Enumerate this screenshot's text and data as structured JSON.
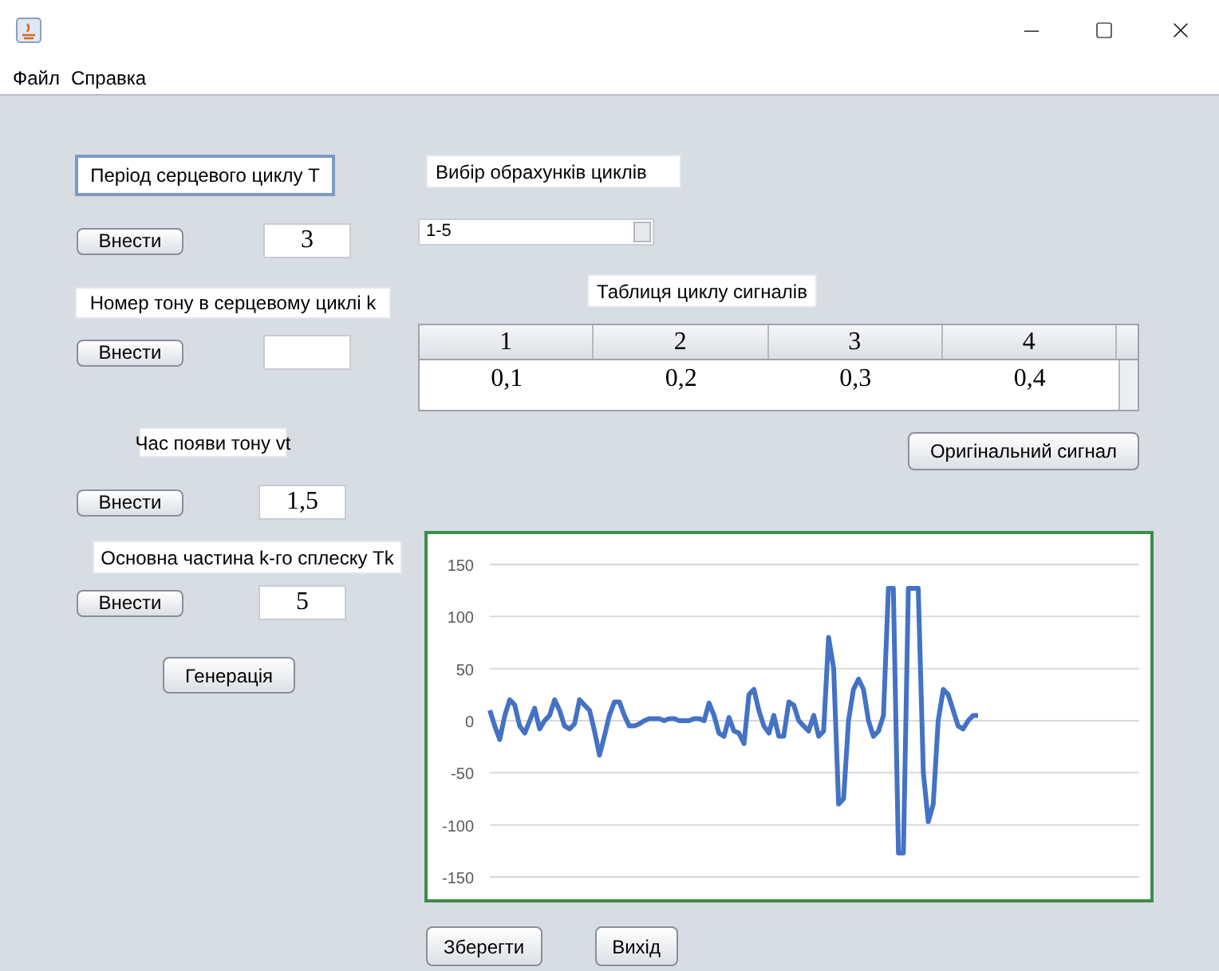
{
  "menu": [
    "Файл",
    "Справка"
  ],
  "left_panel": {
    "fields": [
      {
        "label": "Період серцевого циклу T",
        "focused": true,
        "button": "Внести",
        "value": "3"
      },
      {
        "label": "Номер тону в серцевому циклі k",
        "focused": false,
        "button": "Внести"
      },
      {
        "label": "Час появи тону vt",
        "focused": false,
        "button": "Внести",
        "value": "1,5"
      },
      {
        "label": "Основна частина k-го сплеску Tk",
        "focused": false,
        "button": "Внести",
        "value": "5"
      }
    ],
    "generate_button": "Генерація"
  },
  "cycle_selection": {
    "label": "Вибір обрахунків циклів",
    "value": "1-5"
  },
  "table": {
    "title": "Таблиця циклу сигналів",
    "columns": [
      "1",
      "2",
      "3",
      "4"
    ],
    "rows": [
      [
        "0,1",
        "0,2",
        "0,3",
        "0,4"
      ]
    ]
  },
  "original_signal_button": "Оригінальний сигнал",
  "chart": {
    "chart_data": {
      "type": "line",
      "ylim": [
        -150,
        150
      ],
      "grid": true,
      "yticks": [
        150,
        100,
        50,
        0,
        -50,
        -100,
        -150
      ],
      "series": [
        {
          "color": "#4472c4",
          "values": [
            10,
            -5,
            -18,
            5,
            20,
            15,
            -5,
            -12,
            0,
            12,
            -8,
            0,
            5,
            20,
            10,
            -5,
            -8,
            -3,
            20,
            15,
            10,
            -10,
            -33,
            -15,
            5,
            18,
            18,
            5,
            -5,
            -5,
            -3,
            0,
            2,
            2,
            2,
            0,
            2,
            2,
            0,
            0,
            0,
            2,
            2,
            0,
            17,
            5,
            -12,
            -15,
            3,
            -10,
            -12,
            -22,
            25,
            30,
            10,
            -5,
            -12,
            5,
            -15,
            -15,
            18,
            15,
            0,
            -5,
            -10,
            5,
            -15,
            -10,
            80,
            50,
            -80,
            -75,
            0,
            30,
            40,
            30,
            0,
            -15,
            -10,
            5,
            127,
            127,
            -127,
            -127,
            127,
            127,
            127,
            -50,
            -97,
            -80,
            0,
            30,
            25,
            10,
            -5,
            -8,
            0,
            5,
            5
          ]
        }
      ]
    }
  },
  "buttons": [
    "Зберегти",
    "Вихід"
  ]
}
